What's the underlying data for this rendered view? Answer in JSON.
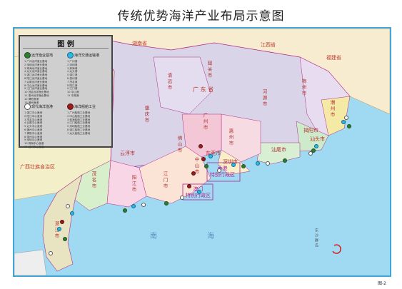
{
  "title": "传统优势海洋产业布局示意图",
  "figure_label": "图-2",
  "legend": {
    "title": "图 例",
    "categories": [
      {
        "label": "远洋渔业基地",
        "color": "#2e7d32"
      },
      {
        "label": "海洋交通运输港",
        "color": "#2bb8e6"
      },
      {
        "label": "现代海洋渔港",
        "color": "#ffffff"
      },
      {
        "label": "海洋船舶工业",
        "color": "#9b1c1c"
      }
    ],
    "list_a": [
      "1 广州远洋渔业基地",
      "2 深圳远洋渔业基地",
      "3 珠海远洋渔业基地",
      "4 汕头远洋渔业基地",
      "5 湛江远洋渔业基地",
      "6 阳江远洋渔业基地",
      "7 汕尾远洋渔业基地",
      "8 中山远洋渔业基地",
      "9 江门远洋渔业基地",
      "10 茂名远洋渔业基地",
      "11 惠州远洋渔业基地",
      "12 揭阳渔港",
      "13 潮州渔港"
    ],
    "list_b": [
      "1 广州港",
      "2 深圳港",
      "3 珠海港",
      "4 汕头港",
      "5 湛江港",
      "6 惠州港",
      "7 茂名港",
      "8 阳江港",
      "9 江门港",
      "10 中山港",
      "11 东莞港"
    ],
    "list_c": [
      "1 湛江中心渔港",
      "2 阳江中心渔港",
      "3 茂名中心渔港",
      "4 汕尾中心渔港",
      "5 汕头中心渔港",
      "6 潮州中心渔港",
      "7 揭阳中心渔港",
      "8 惠州中心渔港",
      "9 深圳中心渔港",
      "10 珠海中心渔港",
      "11 江门中心渔港"
    ],
    "list_d": [
      "1 广州船舶工业基地",
      "2 中山船舶工业基地",
      "3 珠海船舶工业基地",
      "4 江门船舶工业基地",
      "5 深圳船舶工业基地",
      "6 湛江船舶工业基地",
      "7 汕头船舶工业基地"
    ]
  },
  "provinces": {
    "hunan": "湖南省",
    "jiangxi": "江西省",
    "fujian": "福建省",
    "guangdong": "广 东 省",
    "guangxi": "广西壮族自治区"
  },
  "cities": {
    "shaoguan": "韶关市",
    "qingyuan": "清远市",
    "heyuan": "河源市",
    "meizhou": "梅州市",
    "chaozhou": "潮州市",
    "zhaoqing": "肇庆市",
    "yunfu": "云浮市",
    "foshan": "佛山市",
    "guangzhou": "广州市",
    "huizhou": "惠州市",
    "dongguan": "东莞市",
    "shenzhen": "深圳市",
    "shanwei": "汕尾市",
    "jieyang": "揭阳市",
    "shantou": "汕头市",
    "zhongshan": "中山市",
    "jiangmen": "江门市",
    "zhuhai": "珠海市",
    "yangjiang": "阳江市",
    "maoming": "茂名市",
    "zhanjiang": "湛江市"
  },
  "sar": {
    "hongkong": "香港\n特别行政区",
    "macau": "澳门\n特别行政区"
  },
  "sea": {
    "nan": "南",
    "hai": "海"
  },
  "islands": "东沙群岛"
}
